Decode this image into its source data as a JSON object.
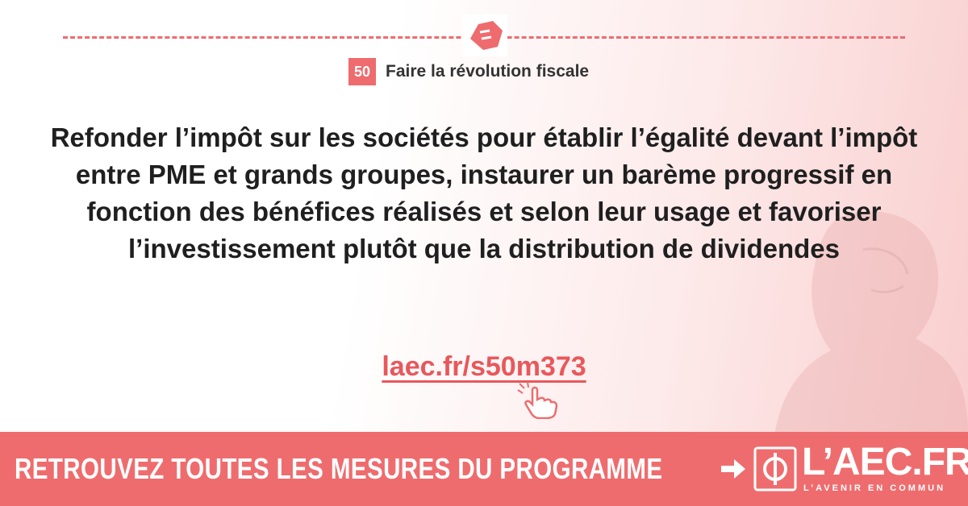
{
  "measure": {
    "number": "50",
    "category": "Faire la révolution fiscale"
  },
  "main_text": "Refonder l’impôt sur les sociétés pour établir l’égalité devant l’impôt entre PME et grands groupes, instaurer un barème progressif en fonction des bénéfices réalisés et selon leur usage et favoriser l’investissement plutôt que la distribution de dividendes",
  "link": "laec.fr/s50m373",
  "banner": {
    "text": "RETROUVEZ TOUTES LES MESURES DU PROGRAMME",
    "logo_main": "L’AEC.FR",
    "logo_sub": "L’AVENIR EN COMMUN"
  },
  "colors": {
    "accent": "#ee6b6e",
    "text": "#1f1f1f"
  },
  "icons": [
    "handshake-icon",
    "click-hand-icon",
    "arrow-right-icon",
    "phi-logo-icon"
  ]
}
